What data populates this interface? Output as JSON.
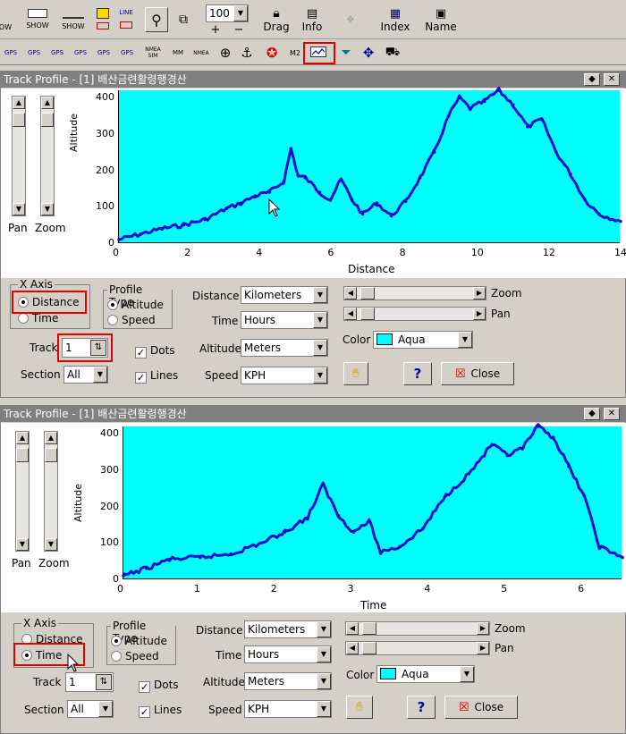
{
  "toolbar_top": {
    "show_label_1": "OW",
    "show_label_2": "SHOW",
    "show_label_3": "SHOW",
    "zoom_value": "100",
    "drag_label": "Drag",
    "info_label": "Info",
    "index_label": "Index",
    "name_label": "Name",
    "plus": "+",
    "minus": "−"
  },
  "toolbar_second": {
    "icons": [
      "GPS",
      "GPS",
      "GPS",
      "GPS",
      "GPS",
      "GPS",
      "NMEA SIM",
      "MM",
      "NMEA",
      "target",
      "anchor",
      "lifebuoy",
      "M2",
      "track-profile",
      "funnel",
      "move",
      "truck"
    ]
  },
  "windows": [
    {
      "title": "Track Profile - [1] 배산금련활령행경산",
      "y_label": "Altitude",
      "x_label": "Distance",
      "pan_label": "Pan",
      "zoom_label": "Zoom",
      "y_ticks": [
        "400",
        "300",
        "200",
        "100",
        "0"
      ],
      "x_ticks": [
        "0",
        "2",
        "4",
        "6",
        "8",
        "10",
        "12",
        "14"
      ],
      "controls": {
        "xaxis_legend": "X Axis",
        "xaxis_distance": "Distance",
        "xaxis_time": "Time",
        "xaxis_selected": "Distance",
        "ptype_legend": "Profile Type",
        "ptype_altitude": "Altitude",
        "ptype_speed": "Speed",
        "track_label": "Track",
        "track_value": "1",
        "section_label": "Section",
        "section_value": "All",
        "dots_label": "Dots",
        "lines_label": "Lines",
        "distance_label": "Distance",
        "distance_value": "Kilometers",
        "time_label": "Time",
        "time_value": "Hours",
        "altitude_label": "Altitude",
        "altitude_value": "Meters",
        "speed_label": "Speed",
        "speed_value": "KPH",
        "zoom_label": "Zoom",
        "pan_label": "Pan",
        "color_label": "Color",
        "color_value": "Aqua",
        "help_label": "?",
        "close_label": "Close"
      }
    },
    {
      "title": "Track Profile - [1] 배산금련활령행경산",
      "y_label": "Altitude",
      "x_label": "Time",
      "pan_label": "Pan",
      "zoom_label": "Zoom",
      "y_ticks": [
        "400",
        "300",
        "200",
        "100",
        "0"
      ],
      "x_ticks": [
        "0",
        "1",
        "2",
        "3",
        "4",
        "5",
        "6"
      ],
      "controls": {
        "xaxis_legend": "X Axis",
        "xaxis_distance": "Distance",
        "xaxis_time": "Time",
        "xaxis_selected": "Time",
        "ptype_legend": "Profile Type",
        "ptype_altitude": "Altitude",
        "ptype_speed": "Speed",
        "track_label": "Track",
        "track_value": "1",
        "section_label": "Section",
        "section_value": "All",
        "dots_label": "Dots",
        "lines_label": "Lines",
        "distance_label": "Distance",
        "distance_value": "Kilometers",
        "time_label": "Time",
        "time_value": "Hours",
        "altitude_label": "Altitude",
        "altitude_value": "Meters",
        "speed_label": "Speed",
        "speed_value": "KPH",
        "zoom_label": "Zoom",
        "pan_label": "Pan",
        "color_label": "Color",
        "color_value": "Aqua",
        "help_label": "?",
        "close_label": "Close"
      }
    }
  ],
  "colors": {
    "plot_bg": "#00ffff",
    "series": "#1010d0",
    "highlight": "#e00000",
    "color_swatch": "#00ffff"
  },
  "chart_data": [
    {
      "type": "line",
      "xlabel": "Distance",
      "ylabel": "Altitude",
      "xlim": [
        0,
        14
      ],
      "ylim": [
        0,
        420
      ],
      "series": [
        {
          "x": [
            0,
            0.6,
            1.2,
            1.8,
            2.4,
            3.0,
            3.4,
            3.8,
            4.2,
            4.6,
            4.8,
            5.0,
            5.2,
            5.6,
            5.9,
            6.2,
            6.5,
            6.8,
            7.2,
            7.6,
            8.0,
            8.4,
            8.8,
            9.2,
            9.5,
            9.8,
            10.2,
            10.6,
            11.0,
            11.4,
            11.8,
            12.2,
            12.6,
            13.0,
            13.4,
            14.0
          ],
          "y": [
            10,
            25,
            40,
            50,
            65,
            95,
            110,
            130,
            140,
            170,
            260,
            185,
            180,
            140,
            120,
            175,
            120,
            80,
            110,
            75,
            115,
            180,
            250,
            350,
            400,
            370,
            390,
            420,
            380,
            320,
            340,
            250,
            190,
            120,
            80,
            60
          ]
        }
      ]
    },
    {
      "type": "line",
      "xlabel": "Time",
      "ylabel": "Altitude",
      "xlim": [
        0,
        6.5
      ],
      "ylim": [
        0,
        420
      ],
      "series": [
        {
          "x": [
            0,
            0.3,
            0.6,
            1.0,
            1.4,
            1.8,
            2.1,
            2.4,
            2.6,
            2.8,
            3.0,
            3.2,
            3.35,
            3.6,
            3.9,
            4.2,
            4.5,
            4.8,
            5.0,
            5.2,
            5.4,
            5.6,
            5.8,
            6.0,
            6.2,
            6.5
          ],
          "y": [
            10,
            30,
            55,
            60,
            70,
            100,
            130,
            170,
            260,
            175,
            130,
            160,
            75,
            90,
            140,
            230,
            290,
            370,
            340,
            360,
            420,
            390,
            310,
            230,
            90,
            60
          ]
        }
      ]
    }
  ]
}
